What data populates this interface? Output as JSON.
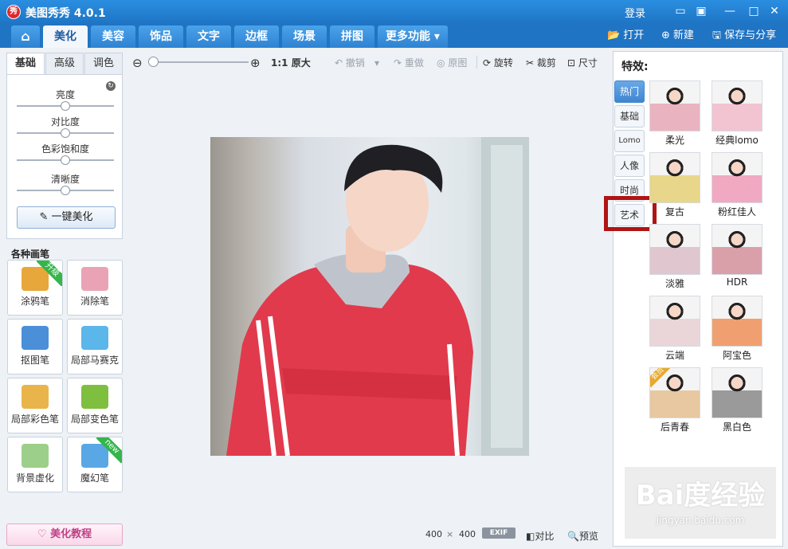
{
  "titlebar": {
    "logo_char": "秀",
    "title": "美图秀秀 4.0.1",
    "login": "登录",
    "buttons": [
      "message-icon",
      "skin-icon",
      "minimize-icon",
      "maximize-icon",
      "close-icon"
    ]
  },
  "nav": {
    "home_icon": "home-icon",
    "tabs": [
      "美化",
      "美容",
      "饰品",
      "文字",
      "边框",
      "场景",
      "拼图",
      "更多功能"
    ],
    "active_tab": "美化",
    "open_label": "打开",
    "new_label": "新建",
    "save_label": "保存与分享"
  },
  "left": {
    "subtabs": [
      "基础",
      "高级",
      "调色"
    ],
    "active_subtab": "基础",
    "adjustments": [
      {
        "label": "亮度",
        "value": 0.5
      },
      {
        "label": "对比度",
        "value": 0.5
      },
      {
        "label": "色彩饱和度",
        "value": 0.5
      },
      {
        "label": "清晰度",
        "value": 0.5
      }
    ],
    "one_key_label": "一键美化",
    "brushes_title": "各种画笔",
    "brushes": [
      {
        "label": "涂鸦笔",
        "badge": "升级",
        "color": "#e8a73a"
      },
      {
        "label": "消除笔",
        "badge": "",
        "color": "#e9a3b5"
      },
      {
        "label": "抠图笔",
        "badge": "",
        "color": "#4a8fd8"
      },
      {
        "label": "局部马赛克",
        "badge": "",
        "color": "#5bb6ea"
      },
      {
        "label": "局部彩色笔",
        "badge": "",
        "color": "#e9b54a"
      },
      {
        "label": "局部变色笔",
        "badge": "",
        "color": "#7fbf3f"
      },
      {
        "label": "背景虚化",
        "badge": "",
        "color": "#9ccf8a"
      },
      {
        "label": "魔幻笔",
        "badge": "new",
        "color": "#5aa7e6"
      }
    ],
    "tutorial_label": "美化教程"
  },
  "toolbar": {
    "zoom_out_icon": "zoom-out-icon",
    "zoom_in_icon": "zoom-in-icon",
    "zoom_value": 0.0,
    "ratio_label": "1:1",
    "original_size_label": "原大",
    "undo_label": "撤销",
    "redo_label": "重做",
    "original_label": "原图",
    "rotate_label": "旋转",
    "crop_label": "裁剪",
    "resize_label": "尺寸"
  },
  "canvas": {
    "width_text": "400",
    "times": "×",
    "height_text": "400",
    "exif_label": "EXIF",
    "compare_label": "对比",
    "preview_label": "预览"
  },
  "right": {
    "title": "特效:",
    "categories": [
      "热门",
      "基础",
      "Lomo",
      "人像",
      "时尚",
      "艺术"
    ],
    "active_category": "热门",
    "highlighted_category": "艺术",
    "effects": [
      {
        "label": "柔光",
        "tint": "#e9b4c0",
        "vip": ""
      },
      {
        "label": "经典lomo",
        "tint": "#f2c4d2",
        "vip": ""
      },
      {
        "label": "复古",
        "tint": "#e8d68a",
        "vip": ""
      },
      {
        "label": "粉红佳人",
        "tint": "#f1a9c1",
        "vip": ""
      },
      {
        "label": "淡雅",
        "tint": "#dfc6cf",
        "vip": ""
      },
      {
        "label": "HDR",
        "tint": "#d9a0aa",
        "vip": ""
      },
      {
        "label": "云端",
        "tint": "#ead5d8",
        "vip": ""
      },
      {
        "label": "阿宝色",
        "tint": "#f0a070",
        "vip": ""
      },
      {
        "label": "后青春",
        "tint": "#e8c8a0",
        "vip": "会员"
      },
      {
        "label": "黑白色",
        "tint": "#9a9a9a",
        "vip": ""
      }
    ]
  },
  "watermark": {
    "text": "Bai度经验",
    "url": "jingyan.baidu.com"
  }
}
